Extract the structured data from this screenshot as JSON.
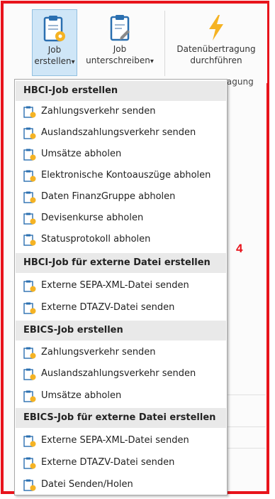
{
  "ribbon": {
    "buttons": [
      {
        "line1": "Job",
        "line2": "erstellen",
        "dropdown": "▾",
        "icon": "clipboard-gear-icon"
      },
      {
        "line1": "Job",
        "line2": "unterschreiben",
        "dropdown": "▾",
        "icon": "clipboard-pen-icon"
      },
      {
        "line1": "Datenübertragung",
        "line2": "durchführen",
        "icon": "lightning-icon"
      }
    ],
    "group_label_partial": "ragung"
  },
  "annotation_number": "4",
  "menu": {
    "sections": [
      {
        "header": "HBCI-Job erstellen",
        "items": [
          "Zahlungsverkehr senden",
          "Auslandszahlungsverkehr senden",
          "Umsätze abholen",
          "Elektronische Kontoauszüge abholen",
          "Daten FinanzGruppe abholen",
          "Devisenkurse abholen",
          "Statusprotokoll abholen"
        ]
      },
      {
        "header": "HBCI-Job für externe Datei erstellen",
        "items": [
          "Externe SEPA-XML-Datei senden",
          "Externe DTAZV-Datei senden"
        ]
      },
      {
        "header": "EBICS-Job erstellen",
        "items": [
          "Zahlungsverkehr senden",
          "Auslandszahlungsverkehr senden",
          "Umsätze abholen"
        ]
      },
      {
        "header": "EBICS-Job für externe Datei erstellen",
        "items": [
          "Externe SEPA-XML-Datei senden",
          "Externe DTAZV-Datei senden",
          "Datei Senden/Holen"
        ]
      }
    ]
  },
  "colors": {
    "annotation_red": "#e8141c",
    "pressed_bg": "#cfe6f7",
    "header_bg": "#e9e9e9",
    "icon_gold": "#f5b324"
  }
}
